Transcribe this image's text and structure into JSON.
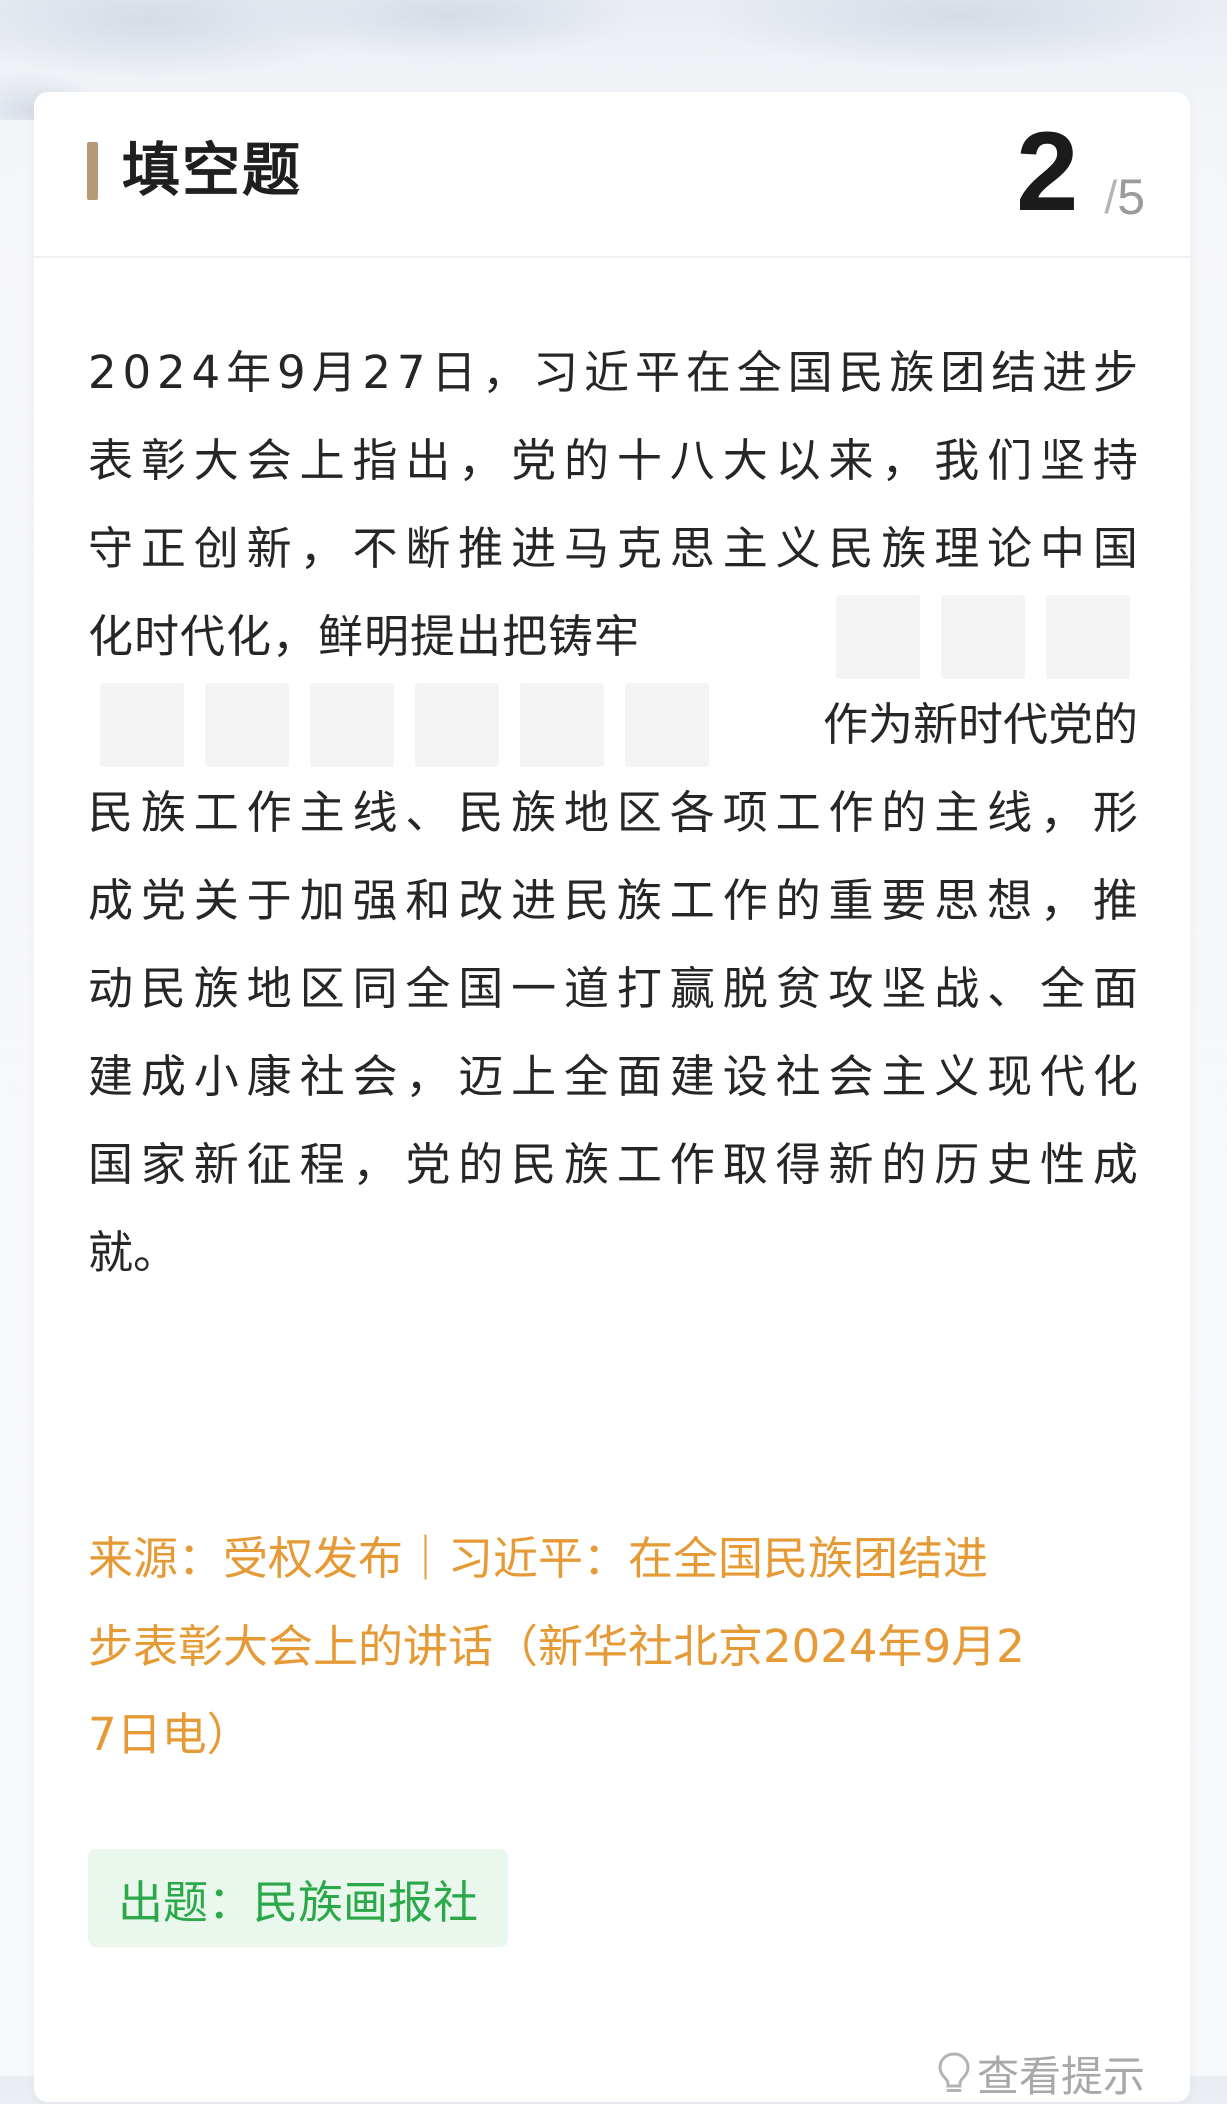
{
  "header": {
    "title": "填空题",
    "current": "2",
    "separator": "/",
    "total": "5"
  },
  "question": {
    "line1": "2024年9月27日，习近平在全国民族团结进步",
    "line2": "表彰大会上指出，党的十八大以来，我们坚持",
    "line3": "守正创新，不断推进马克思主义民族理论中国",
    "line4_text": "化时代化，鲜明提出把铸牢",
    "line5_text": "作为新时代党的",
    "line6": "民族工作主线、民族地区各项工作的主线，形",
    "line7": "成党关于加强和改进民族工作的重要思想，推",
    "line8": "动民族地区同全国一道打赢脱贫攻坚战、全面",
    "line9": "建成小康社会，迈上全面建设社会主义现代化",
    "line10": "国家新征程，党的民族工作取得新的历史性成",
    "line11": "就。",
    "blank_count": 9
  },
  "source": {
    "line1": "来源：受权发布｜习近平：在全国民族团结进",
    "line2": "步表彰大会上的讲话（新华社北京2024年9月2",
    "line3": "7日电）"
  },
  "author": {
    "label": "出题：民族画报社"
  },
  "hint": {
    "label": "查看提示",
    "icon": "lightbulb-icon"
  },
  "colors": {
    "accent_bar": "#b69a78",
    "source_text": "#e69a36",
    "author_text": "#2aa84a",
    "author_bg": "#e9f7ec"
  }
}
